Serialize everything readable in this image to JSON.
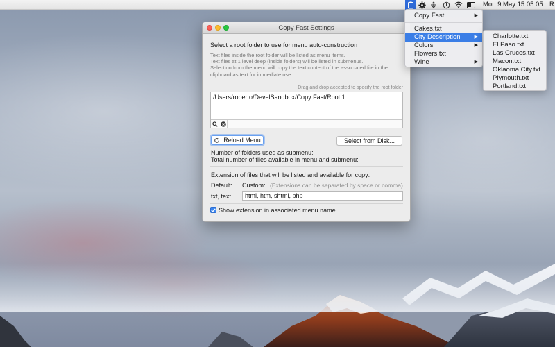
{
  "menubar": {
    "clock": "Mon 9 May  15:05:05",
    "clock_overflow": "R",
    "tray_icons": [
      "copy-fast-icon",
      "gear-icon",
      "network-arrows-icon",
      "time-machine-icon",
      "wifi-icon",
      "display-icon"
    ]
  },
  "app_menu": {
    "items": [
      {
        "label": "Copy Fast",
        "submenu": true
      },
      {
        "label": "Cakes.txt",
        "submenu": false
      },
      {
        "label": "City Description",
        "submenu": true,
        "selected": true
      },
      {
        "label": "Colors",
        "submenu": true
      },
      {
        "label": "Flowers.txt",
        "submenu": false
      },
      {
        "label": "Wine",
        "submenu": true
      }
    ]
  },
  "submenu": {
    "items": [
      "Charlotte.txt",
      "El Paso.txt",
      "Las Cruces.txt",
      "Macon.txt",
      "Oklaoma City.txt",
      "Plymouth.txt",
      "Portland.txt"
    ]
  },
  "window": {
    "title": "Copy Fast Settings",
    "heading": "Select a root folder to use for menu auto-construction",
    "notes": [
      "Text files inside the root folder will be listed as menu items.",
      "Text files at 1 level deep (inside folders) will be listed in submenus.",
      "Selection from the menu will copy the text content of the associated file in the",
      "clipboard as text for immediate use"
    ],
    "drag_note": "Drag and drop accepted to specify the root folder",
    "root_path": "/Users/roberto/DevelSandbox/Copy Fast/Root 1",
    "reload_button": "Reload Menu",
    "select_button": "Select from Disk...",
    "folders_label": "Number of folders used as submenu:",
    "files_label": "Total number of files available in menu and submenu:",
    "extensions_heading": "Extension of files that will be listed and available for copy:",
    "default_label": "Default:",
    "custom_label": "Custom:",
    "custom_hint": "(Extensions can be separated by space or comma)",
    "default_value": "txt, text",
    "custom_value": "html, htm, shtml, php",
    "show_extension_label": "Show extension in associated menu name",
    "show_extension_checked": true
  },
  "colors": {
    "accent": "#3b7ee6",
    "close": "#fc5f57",
    "minimize": "#fdbc2e",
    "maximize": "#28c840"
  }
}
